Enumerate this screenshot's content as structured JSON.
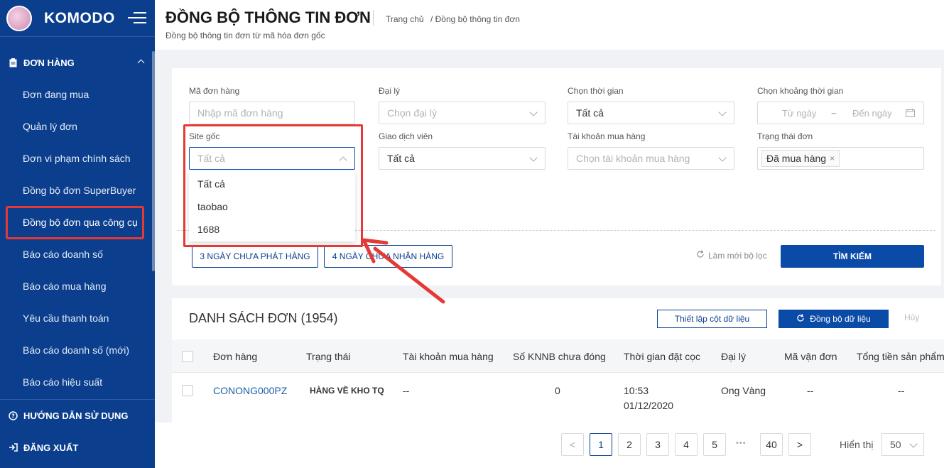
{
  "app": {
    "brand": "KOMODO"
  },
  "sidebar": {
    "section_orders": "ĐƠN HÀNG",
    "items": [
      {
        "label": "Đơn đang mua"
      },
      {
        "label": "Quản lý đơn"
      },
      {
        "label": "Đơn vi phạm chính sách"
      },
      {
        "label": "Đồng bộ đơn SuperBuyer"
      },
      {
        "label": "Đồng bộ đơn qua công cụ"
      },
      {
        "label": "Báo cáo doanh số"
      },
      {
        "label": "Báo cáo mua hàng"
      },
      {
        "label": "Yêu cầu thanh toán"
      },
      {
        "label": "Báo cáo doanh số (mới)"
      },
      {
        "label": "Báo cáo hiệu suất"
      }
    ],
    "guide": "HƯỚNG DẪN SỬ DỤNG",
    "logout": "ĐĂNG XUẤT"
  },
  "header": {
    "title": "ĐỒNG BỘ THÔNG TIN ĐƠN",
    "subtitle": "Đồng bộ thông tin đơn từ mã hóa đơn gốc",
    "breadcrumb_home": "Trang chủ",
    "breadcrumb_current": "/ Đồng bộ thông tin đơn"
  },
  "filters": {
    "order_code_label": "Mã đơn hàng",
    "order_code_placeholder": "Nhập mã đơn hàng",
    "agent_label": "Đại lý",
    "agent_placeholder": "Chọn đại lý",
    "time_label": "Chọn thời gian",
    "time_value": "Tất cả",
    "range_label": "Chọn khoảng thời gian",
    "range_from": "Từ ngày",
    "range_sep": "~",
    "range_to": "Đến ngày",
    "site_label": "Site gốc",
    "site_value": "Tất cả",
    "trader_label": "Giao dịch viên",
    "trader_value": "Tất cả",
    "account_label": "Tài khoản mua hàng",
    "account_placeholder": "Chọn tài khoản mua hàng",
    "status_label": "Trạng thái đơn",
    "status_tag": "Đã mua hàng",
    "site_options": [
      "Tất cả",
      "taobao",
      "1688"
    ],
    "quick_btn_1": "3 NGÀY CHƯA PHÁT HÀNG",
    "quick_btn_2": "4 NGÀY CHƯA NHẬN HÀNG",
    "refresh": "Làm mới bộ lọc",
    "search": "TÌM KIẾM"
  },
  "list": {
    "title": "DANH SÁCH ĐƠN (1954)",
    "setup_btn": "Thiết lập cột dữ liệu",
    "sync_btn": "Đồng bộ dữ liệu",
    "cancel_btn": "Hủy",
    "columns": [
      "Đơn hàng",
      "Trạng thái",
      "Tài khoản mua hàng",
      "Số KNNB chưa đóng",
      "Thời gian đặt cọc",
      "Đại lý",
      "Mã vận đơn",
      "Tổng tiền sản phẩm"
    ],
    "rows": [
      {
        "order": "CONONG000PZ",
        "status": "HÀNG VỀ KHO TQ",
        "account": "--",
        "knnb": "0",
        "deposit_time": "10:53",
        "deposit_date": "01/12/2020",
        "agent": "Ong Vàng",
        "tracking": "--",
        "total": "--"
      }
    ]
  },
  "pagination": {
    "prev": "<",
    "pages": [
      "1",
      "2",
      "3",
      "4",
      "5"
    ],
    "ellipsis": "•••",
    "last": "40",
    "next": ">",
    "current": "1",
    "show_label": "Hiển thị",
    "page_size": "50"
  },
  "colors": {
    "primary": "#0b3f8e",
    "highlight": "#e53935"
  }
}
